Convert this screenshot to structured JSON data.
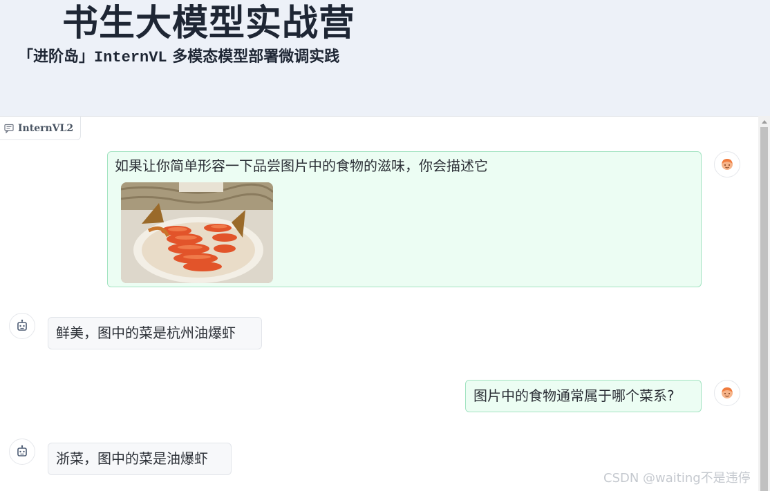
{
  "header": {
    "title": "书生大模型实战营",
    "subtitle_prefix": "「进阶岛」",
    "subtitle_model": "InternVL",
    "subtitle_suffix": " 多模态模型部署微调实践"
  },
  "chatbot": {
    "label": "InternVL2",
    "label_icon": "chat-icon"
  },
  "messages": [
    {
      "role": "user",
      "text": "如果让你简单形容一下品尝图片中的食物的滋味，你会描述它",
      "has_image": true,
      "image_desc_icon": "food-image"
    },
    {
      "role": "assistant",
      "text": "鲜美，图中的菜是杭州油爆虾"
    },
    {
      "role": "user",
      "text": "图片中的食物通常属于哪个菜系?"
    },
    {
      "role": "assistant",
      "text": "浙菜，图中的菜是油爆虾"
    }
  ],
  "watermark": "CSDN @waiting不是违停",
  "colors": {
    "header_bg": "#edf1f8",
    "user_bubble_bg": "#ecfdf3",
    "user_bubble_border": "#a2e3c1",
    "bot_bubble_bg": "#f7f8fa",
    "user_avatar": "#f07c3e",
    "bot_avatar": "#4b5a72"
  }
}
